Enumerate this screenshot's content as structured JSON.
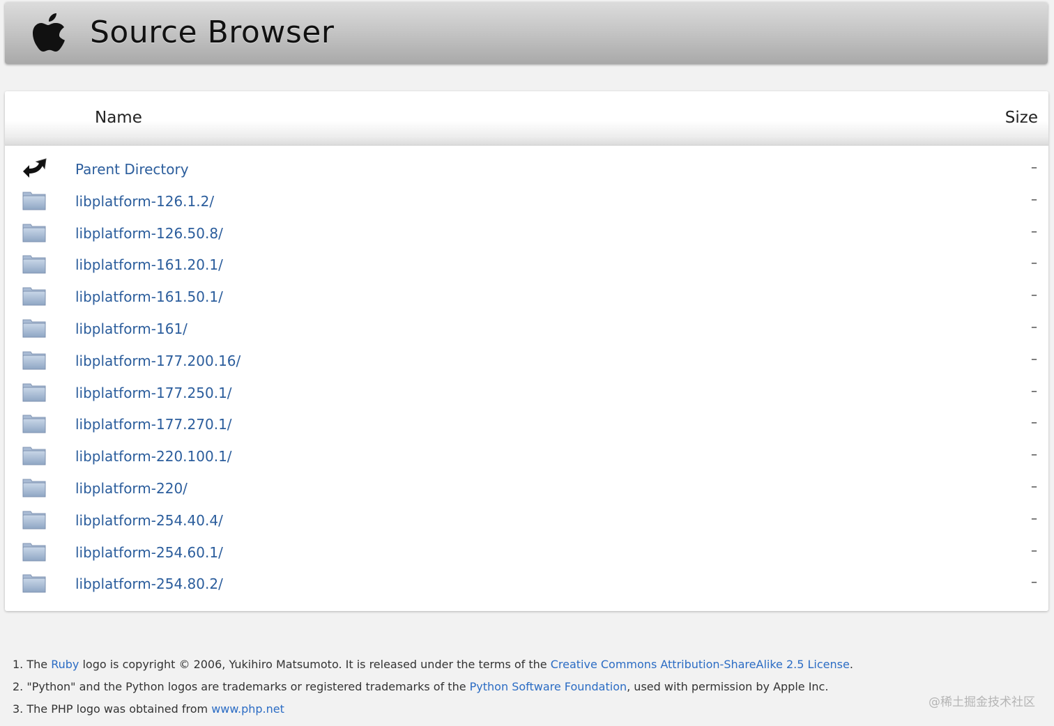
{
  "header": {
    "title": "Source Browser",
    "logo_icon": "apple-logo-icon"
  },
  "table": {
    "columns": {
      "name": "Name",
      "size": "Size"
    },
    "rows": [
      {
        "name": "Parent Directory",
        "size": "–",
        "icon": "parent-directory-icon"
      },
      {
        "name": "libplatform-126.1.2/",
        "size": "–",
        "icon": "folder-icon"
      },
      {
        "name": "libplatform-126.50.8/",
        "size": "–",
        "icon": "folder-icon"
      },
      {
        "name": "libplatform-161.20.1/",
        "size": "–",
        "icon": "folder-icon"
      },
      {
        "name": "libplatform-161.50.1/",
        "size": "–",
        "icon": "folder-icon"
      },
      {
        "name": "libplatform-161/",
        "size": "–",
        "icon": "folder-icon"
      },
      {
        "name": "libplatform-177.200.16/",
        "size": "–",
        "icon": "folder-icon"
      },
      {
        "name": "libplatform-177.250.1/",
        "size": "–",
        "icon": "folder-icon"
      },
      {
        "name": "libplatform-177.270.1/",
        "size": "–",
        "icon": "folder-icon"
      },
      {
        "name": "libplatform-220.100.1/",
        "size": "–",
        "icon": "folder-icon"
      },
      {
        "name": "libplatform-220/",
        "size": "–",
        "icon": "folder-icon"
      },
      {
        "name": "libplatform-254.40.4/",
        "size": "–",
        "icon": "folder-icon"
      },
      {
        "name": "libplatform-254.60.1/",
        "size": "–",
        "icon": "folder-icon"
      },
      {
        "name": "libplatform-254.80.2/",
        "size": "–",
        "icon": "folder-icon"
      }
    ]
  },
  "footnotes": [
    {
      "number": "1.",
      "text_a": "The ",
      "link_a": "Ruby",
      "text_b": " logo is copyright © 2006, Yukihiro Matsumoto. It is released under the terms of the ",
      "link_b": "Creative Commons Attribution-ShareAlike 2.5 License",
      "text_c": "."
    },
    {
      "number": "2.",
      "text_a": "\"Python\" and the Python logos are trademarks or registered trademarks of the ",
      "link_a": "Python Software Foundation",
      "text_b": ", used with permission by Apple Inc."
    },
    {
      "number": "3.",
      "text_a": "The PHP logo was obtained from ",
      "link_a": "www.php.net"
    }
  ],
  "watermark": "@稀土掘金技术社区",
  "colors": {
    "link": "#2b5d9c",
    "footnote_link": "#2b6cc4",
    "background": "#f2f2f2"
  }
}
